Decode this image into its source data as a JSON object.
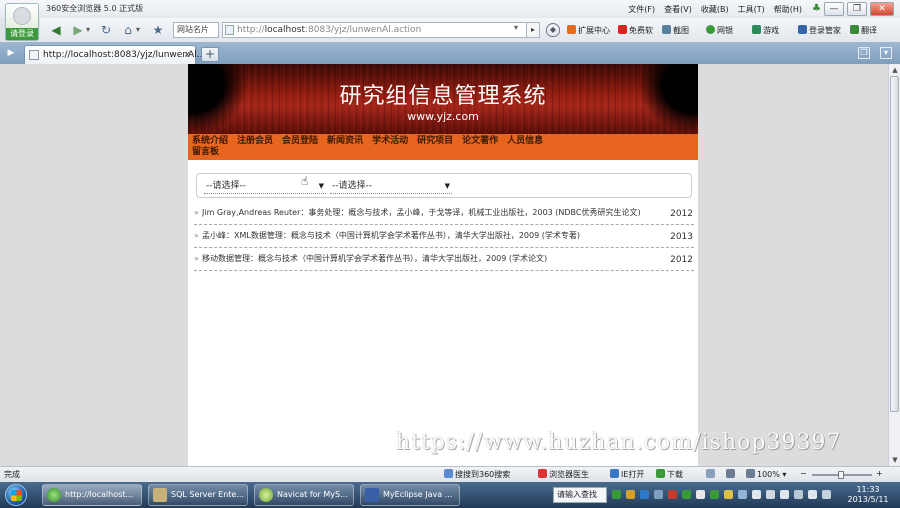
{
  "browser": {
    "logo_label": "请登录",
    "title": "360安全浏览器 5.0 正式版",
    "menus": [
      "文件(F)",
      "查看(V)",
      "收藏(B)",
      "工具(T)",
      "帮助(H)"
    ],
    "window_buttons": [
      "—",
      "❐",
      "✕"
    ],
    "favorites_label": "网站名片",
    "address_prefix": "http://",
    "address_host": "localhost",
    "address_rest": ":8083/yjz/lunwenAl.action",
    "toolbar": [
      "扩展中心",
      "免费软",
      "截图",
      "网银",
      "游戏",
      "登录管家",
      "翻译"
    ],
    "tab_title": "http://localhost:8083/yjz/lunwenAl..."
  },
  "site": {
    "title": "研究组信息管理系统",
    "url": "www.yjz.com",
    "nav_row1": [
      "系统介绍",
      "注册会员",
      "会员登陆",
      "新闻资讯",
      "学术活动",
      "研究项目",
      "论文著作",
      "人员信息"
    ],
    "nav_row2": [
      "留言板"
    ],
    "filter1": "--请选择--",
    "filter2": "--请选择--",
    "papers": [
      {
        "text": "Jim Gray,Andreas Reuter：事务处理：概念与技术，孟小峰，于戈等译，机械工业出版社，2003 (NDBC优秀研究生论文)",
        "year": "2012"
      },
      {
        "text": "孟小峰：XML数据管理：概念与技术（中国计算机学会学术著作丛书），清华大学出版社，2009 (学术专著)",
        "year": "2013"
      },
      {
        "text": "移动数据管理：概念与技术（中国计算机学会学术著作丛书），清华大学出版社，2009 (学术论文)",
        "year": "2012"
      }
    ]
  },
  "watermark": "https://www.huzhan.com/ishop39397",
  "status": {
    "text": "完成",
    "search": "搜搜到360搜索",
    "doctor": "浏览器医生",
    "open": "IE打开",
    "download": "下载",
    "zoom": "100%"
  },
  "taskbar": {
    "items": [
      "http://localhost...",
      "SQL Server Ente...",
      "Navicat for MyS...",
      "MyEclipse Java ..."
    ],
    "ime": "请输入查找",
    "time": "11:33",
    "date": "2013/5/11"
  },
  "colors": {
    "nav_orange": "#e8651f",
    "banner_red": "#a4261a",
    "taskbar_blue": "#2b4a6e"
  }
}
